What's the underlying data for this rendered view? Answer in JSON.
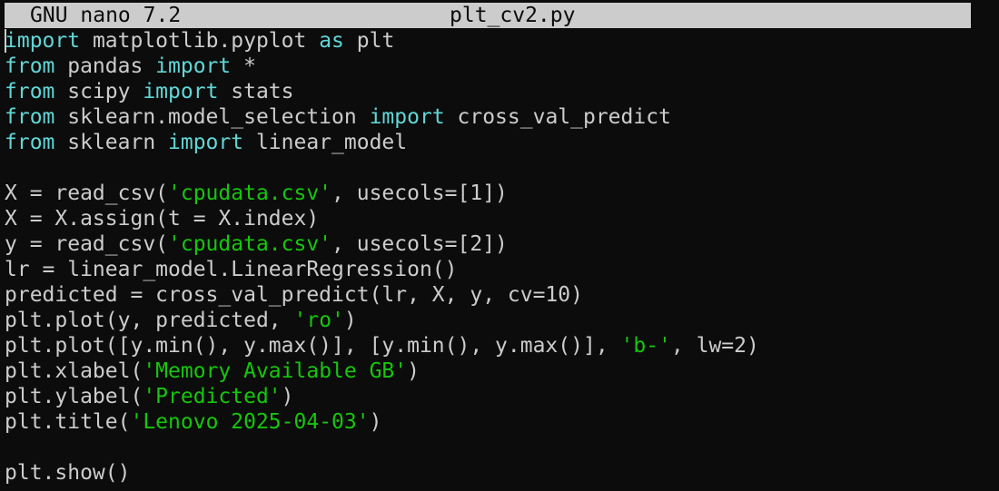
{
  "titlebar": {
    "app": "GNU nano 7.2",
    "filename": "plt_cv2.py"
  },
  "colors": {
    "background": "#0c0c0c",
    "text": "#cccccc",
    "keyword": "#61d6d6",
    "string": "#16c60c",
    "titlebar_bg": "#cccccc"
  },
  "lines": [
    [
      {
        "t": "import",
        "k": "kw"
      },
      {
        "t": " matplotlib.pyplot ",
        "k": ""
      },
      {
        "t": "as",
        "k": "kw"
      },
      {
        "t": " plt",
        "k": ""
      }
    ],
    [
      {
        "t": "from",
        "k": "kw"
      },
      {
        "t": " pandas ",
        "k": ""
      },
      {
        "t": "import",
        "k": "kw"
      },
      {
        "t": " *",
        "k": ""
      }
    ],
    [
      {
        "t": "from",
        "k": "kw"
      },
      {
        "t": " scipy ",
        "k": ""
      },
      {
        "t": "import",
        "k": "kw"
      },
      {
        "t": " stats",
        "k": ""
      }
    ],
    [
      {
        "t": "from",
        "k": "kw"
      },
      {
        "t": " sklearn.model_selection ",
        "k": ""
      },
      {
        "t": "import",
        "k": "kw"
      },
      {
        "t": " cross_val_predict",
        "k": ""
      }
    ],
    [
      {
        "t": "from",
        "k": "kw"
      },
      {
        "t": " sklearn ",
        "k": ""
      },
      {
        "t": "import",
        "k": "kw"
      },
      {
        "t": " linear_model",
        "k": ""
      }
    ],
    [],
    [
      {
        "t": "X = read_csv(",
        "k": ""
      },
      {
        "t": "'cpudata.csv'",
        "k": "str"
      },
      {
        "t": ", usecols=[1])",
        "k": ""
      }
    ],
    [
      {
        "t": "X = X.assign(t = X.index)",
        "k": ""
      }
    ],
    [
      {
        "t": "y = read_csv(",
        "k": ""
      },
      {
        "t": "'cpudata.csv'",
        "k": "str"
      },
      {
        "t": ", usecols=[2])",
        "k": ""
      }
    ],
    [
      {
        "t": "lr = linear_model.LinearRegression()",
        "k": ""
      }
    ],
    [
      {
        "t": "predicted = cross_val_predict(lr, X, y, cv=10)",
        "k": ""
      }
    ],
    [
      {
        "t": "plt.plot(y, predicted, ",
        "k": ""
      },
      {
        "t": "'ro'",
        "k": "str"
      },
      {
        "t": ")",
        "k": ""
      }
    ],
    [
      {
        "t": "plt.plot([y.min(), y.max()], [y.min(), y.max()], ",
        "k": ""
      },
      {
        "t": "'b-'",
        "k": "str"
      },
      {
        "t": ", lw=2)",
        "k": ""
      }
    ],
    [
      {
        "t": "plt.xlabel(",
        "k": ""
      },
      {
        "t": "'Memory Available GB'",
        "k": "str"
      },
      {
        "t": ")",
        "k": ""
      }
    ],
    [
      {
        "t": "plt.ylabel(",
        "k": ""
      },
      {
        "t": "'Predicted'",
        "k": "str"
      },
      {
        "t": ")",
        "k": ""
      }
    ],
    [
      {
        "t": "plt.title(",
        "k": ""
      },
      {
        "t": "'Lenovo 2025-04-03'",
        "k": "str"
      },
      {
        "t": ")",
        "k": ""
      }
    ],
    [],
    [
      {
        "t": "plt.show()",
        "k": ""
      }
    ]
  ]
}
